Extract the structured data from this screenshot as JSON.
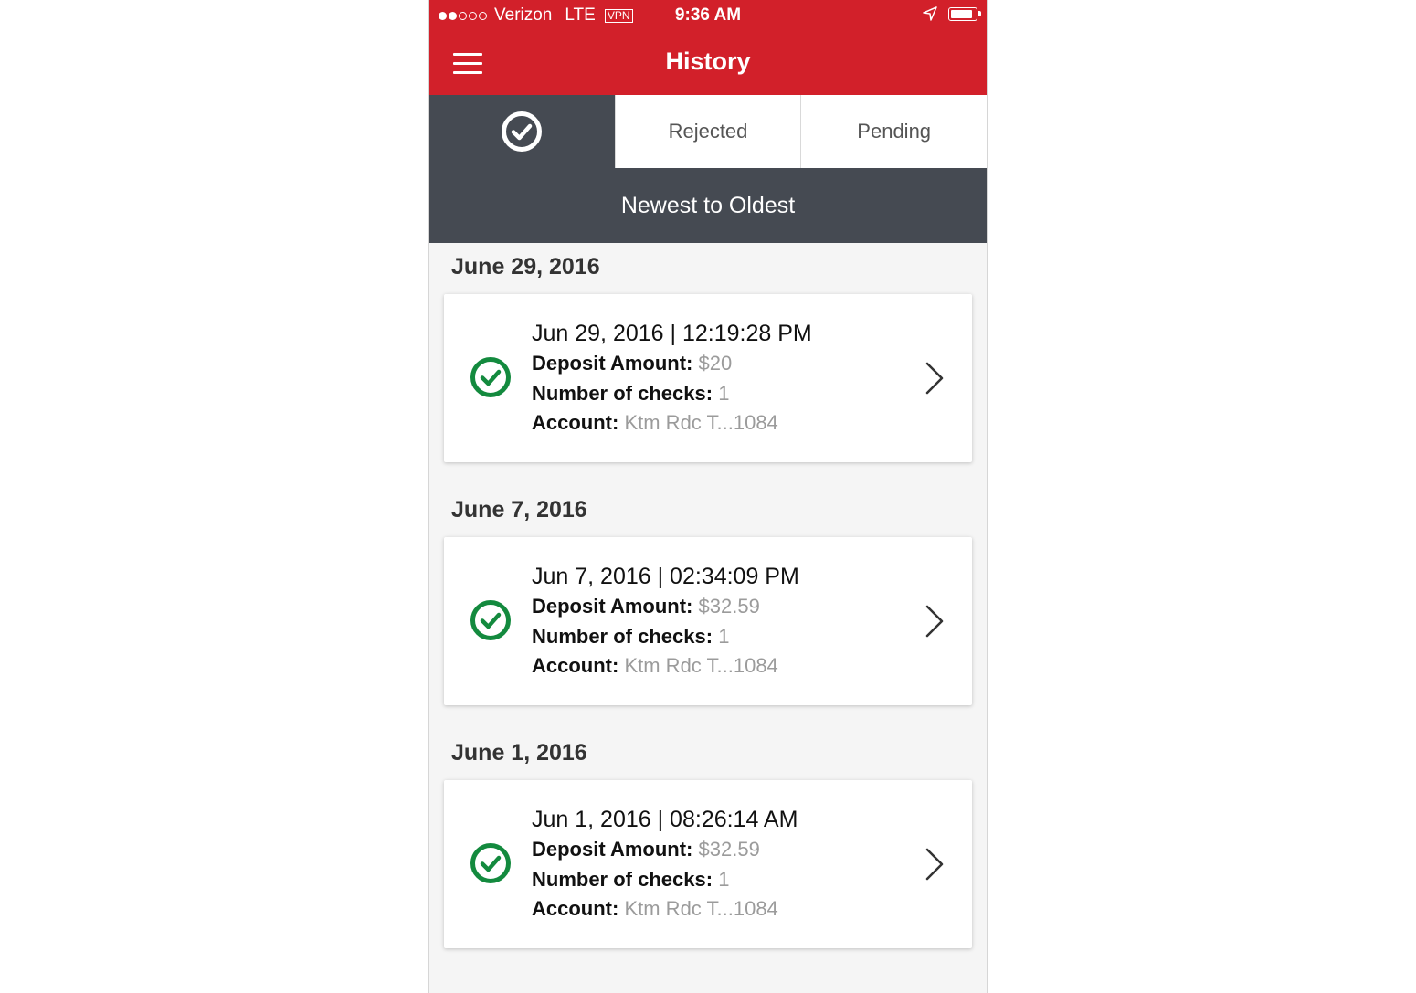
{
  "status_bar": {
    "carrier": "Verizon",
    "network": "LTE",
    "vpn": "VPN",
    "time": "9:36 AM",
    "signal_dots_filled": 2,
    "signal_dots_total": 5
  },
  "navbar": {
    "title": "History",
    "menu_icon": "hamburger-icon"
  },
  "tabs": [
    {
      "label": "",
      "icon": "check-circle-icon",
      "active": true
    },
    {
      "label": "Rejected",
      "active": false
    },
    {
      "label": "Pending",
      "active": false
    }
  ],
  "sort": {
    "label": "Newest to Oldest"
  },
  "groups": [
    {
      "date": "June 29, 2016",
      "item": {
        "datetime": "Jun 29, 2016 | 12:19:28 PM",
        "deposit_label": "Deposit Amount:",
        "deposit_value": "$20",
        "checks_label": "Number of checks:",
        "checks_value": "1",
        "account_label": "Account:",
        "account_value": "Ktm Rdc T...1084"
      }
    },
    {
      "date": "June 7, 2016",
      "item": {
        "datetime": "Jun 7, 2016 | 02:34:09 PM",
        "deposit_label": "Deposit Amount:",
        "deposit_value": "$32.59",
        "checks_label": "Number of checks:",
        "checks_value": "1",
        "account_label": "Account:",
        "account_value": "Ktm Rdc T...1084"
      }
    },
    {
      "date": "June 1, 2016",
      "item": {
        "datetime": "Jun 1, 2016 | 08:26:14 AM",
        "deposit_label": "Deposit Amount:",
        "deposit_value": "$32.59",
        "checks_label": "Number of checks:",
        "checks_value": "1",
        "account_label": "Account:",
        "account_value": "Ktm Rdc T...1084"
      }
    }
  ],
  "colors": {
    "brand_red": "#d2202a",
    "dark_bar": "#454a52",
    "success_green": "#138a3e",
    "muted_value": "#9b9b9b"
  }
}
